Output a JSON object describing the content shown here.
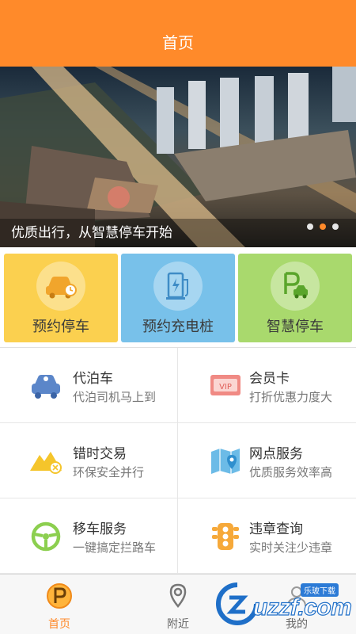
{
  "header": {
    "title": "首页"
  },
  "banner": {
    "caption": "优质出行，从智慧停车开始",
    "page_count": 3,
    "active_page": 2
  },
  "tiles": [
    {
      "label": "预约停车",
      "icon": "car-clock-icon",
      "color": "#fbd04f"
    },
    {
      "label": "预约充电桩",
      "icon": "charging-station-icon",
      "color": "#78c1ea"
    },
    {
      "label": "智慧停车",
      "icon": "parking-car-icon",
      "color": "#a9d96d"
    }
  ],
  "services": [
    {
      "name": "代泊车",
      "desc": "代泊司机马上到",
      "icon": "car-icon"
    },
    {
      "name": "会员卡",
      "desc": "打折优惠力度大",
      "icon": "vip-card-icon"
    },
    {
      "name": "错时交易",
      "desc": "环保安全并行",
      "icon": "mountain-clock-icon"
    },
    {
      "name": "网点服务",
      "desc": "优质服务效率高",
      "icon": "map-pin-icon"
    },
    {
      "name": "移车服务",
      "desc": "一键搞定拦路车",
      "icon": "steering-wheel-icon"
    },
    {
      "name": "违章查询",
      "desc": "实时关注少违章",
      "icon": "traffic-light-icon"
    }
  ],
  "tabbar": {
    "items": [
      {
        "label": "首页",
        "icon": "parking-p-icon",
        "active": true
      },
      {
        "label": "附近",
        "icon": "location-pin-icon",
        "active": false
      },
      {
        "label": "我的",
        "icon": "profile-icon",
        "active": false
      }
    ]
  },
  "watermark": {
    "text": "uzzf.com",
    "tag": "乐玻下载"
  },
  "colors": {
    "accent": "#ff8a2a",
    "tile_yellow": "#fbd04f",
    "tile_blue": "#78c1ea",
    "tile_green": "#a9d96d"
  }
}
